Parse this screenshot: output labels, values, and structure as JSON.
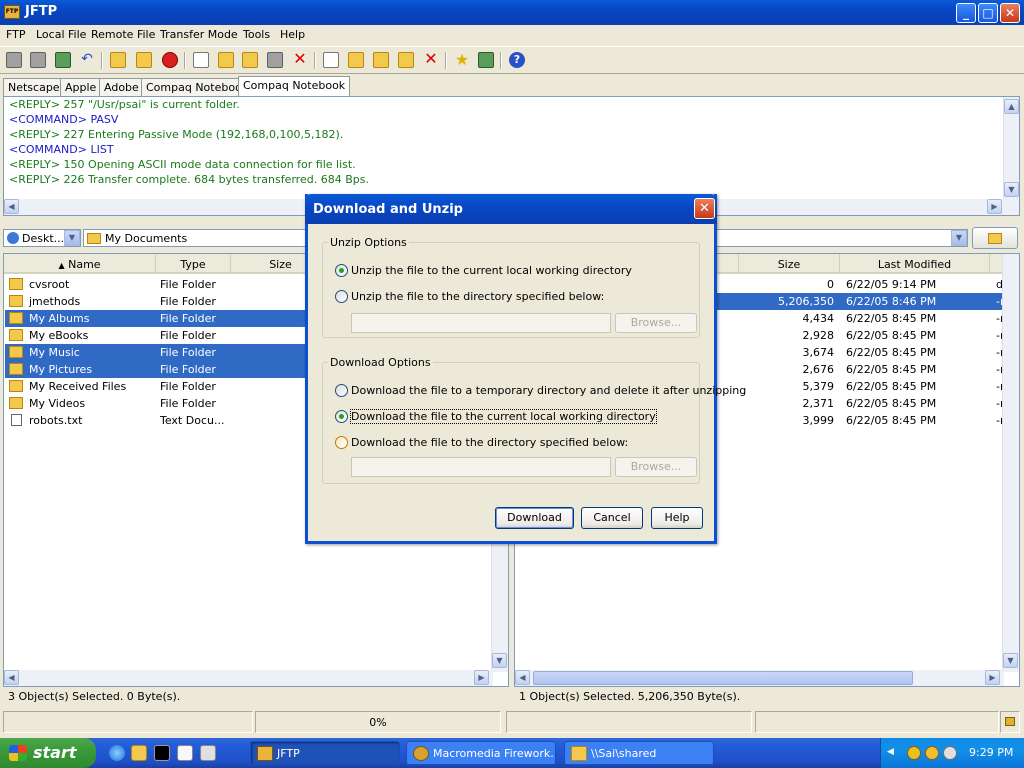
{
  "window": {
    "title": "JFTP",
    "icon_text": "FTP"
  },
  "menu": [
    "FTP",
    "Local File",
    "Remote File",
    "Transfer Mode",
    "Tools",
    "Help"
  ],
  "tabs": [
    "Netscape",
    "Apple",
    "Adobe",
    "Compaq Notebook",
    "Compaq Notebook"
  ],
  "active_tab_index": 4,
  "log": [
    {
      "kind": "reply",
      "text": "<REPLY> 257 \"/Usr/psai\" is current folder."
    },
    {
      "kind": "command",
      "text": "<COMMAND> PASV"
    },
    {
      "kind": "reply",
      "text": "<REPLY> 227 Entering Passive Mode (192,168,0,100,5,182)."
    },
    {
      "kind": "command",
      "text": "<COMMAND> LIST"
    },
    {
      "kind": "reply",
      "text": "<REPLY> 150 Opening ASCII mode data connection for file list."
    },
    {
      "kind": "reply",
      "text": "<REPLY> 226 Transfer complete. 684 bytes transferred. 684 Bps."
    }
  ],
  "local": {
    "drive": "Deskt...",
    "path": "My Documents",
    "columns": [
      "Name",
      "Type",
      "Size"
    ],
    "files": [
      {
        "name": "cvsroot",
        "type": "File Folder",
        "selected": false,
        "icon": "folder-icon"
      },
      {
        "name": "jmethods",
        "type": "File Folder",
        "selected": false,
        "icon": "folder-icon"
      },
      {
        "name": "My Albums",
        "type": "File Folder",
        "selected": true,
        "icon": "folder-icon"
      },
      {
        "name": "My eBooks",
        "type": "File Folder",
        "selected": false,
        "icon": "folder-icon"
      },
      {
        "name": "My Music",
        "type": "File Folder",
        "selected": true,
        "icon": "folder-icon"
      },
      {
        "name": "My Pictures",
        "type": "File Folder",
        "selected": true,
        "icon": "folder-icon"
      },
      {
        "name": "My Received Files",
        "type": "File Folder",
        "selected": false,
        "icon": "folder-icon"
      },
      {
        "name": "My Videos",
        "type": "File Folder",
        "selected": false,
        "icon": "folder-icon"
      },
      {
        "name": "robots.txt",
        "type": "Text Docu...",
        "selected": false,
        "icon": "text-file-icon"
      }
    ],
    "status": "3 Object(s) Selected. 0 Byte(s)."
  },
  "remote": {
    "columns": [
      "Size",
      "Last Modified"
    ],
    "files": [
      {
        "size": "0",
        "modified": "6/22/05 9:14 PM",
        "attr": "d",
        "selected": false
      },
      {
        "size": "5,206,350",
        "modified": "6/22/05 8:46 PM",
        "attr": "-r",
        "selected": true
      },
      {
        "size": "4,434",
        "modified": "6/22/05 8:45 PM",
        "attr": "-r",
        "selected": false
      },
      {
        "size": "2,928",
        "modified": "6/22/05 8:45 PM",
        "attr": "-r",
        "selected": false
      },
      {
        "size": "3,674",
        "modified": "6/22/05 8:45 PM",
        "attr": "-r",
        "selected": false
      },
      {
        "size": "2,676",
        "modified": "6/22/05 8:45 PM",
        "attr": "-r",
        "selected": false
      },
      {
        "size": "5,379",
        "modified": "6/22/05 8:45 PM",
        "attr": "-r",
        "selected": false
      },
      {
        "size": "2,371",
        "modified": "6/22/05 8:45 PM",
        "attr": "-r",
        "selected": false
      },
      {
        "size": "3,999",
        "modified": "6/22/05 8:45 PM",
        "attr": "-r",
        "selected": false
      }
    ],
    "status": "1 Object(s) Selected. 5,206,350 Byte(s)."
  },
  "progress_text": "0%",
  "dialog": {
    "title": "Download and Unzip",
    "unzip_group": "Unzip Options",
    "unzip_options": [
      {
        "label": "Unzip the file to the current local working directory",
        "checked": true
      },
      {
        "label": "Unzip the file to the directory specified below:",
        "checked": false
      }
    ],
    "download_group": "Download Options",
    "download_options": [
      {
        "label": "Download the file to a temporary directory and delete it after unzipping",
        "checked": false
      },
      {
        "label": "Download the file to the current local working directory",
        "checked": true
      },
      {
        "label": "Download the file to the directory specified below:",
        "checked": false
      }
    ],
    "browse_label": "Browse...",
    "unzip_dir_value": "",
    "download_dir_value": "",
    "download_button": "Download",
    "cancel_button": "Cancel",
    "help_button": "Help"
  },
  "taskbar": {
    "start_label": "start",
    "tasks": [
      "JFTP",
      "Macromedia Firework...",
      "\\\\Sai\\shared"
    ],
    "active_task_index": 0,
    "clock": "9:29 PM"
  }
}
